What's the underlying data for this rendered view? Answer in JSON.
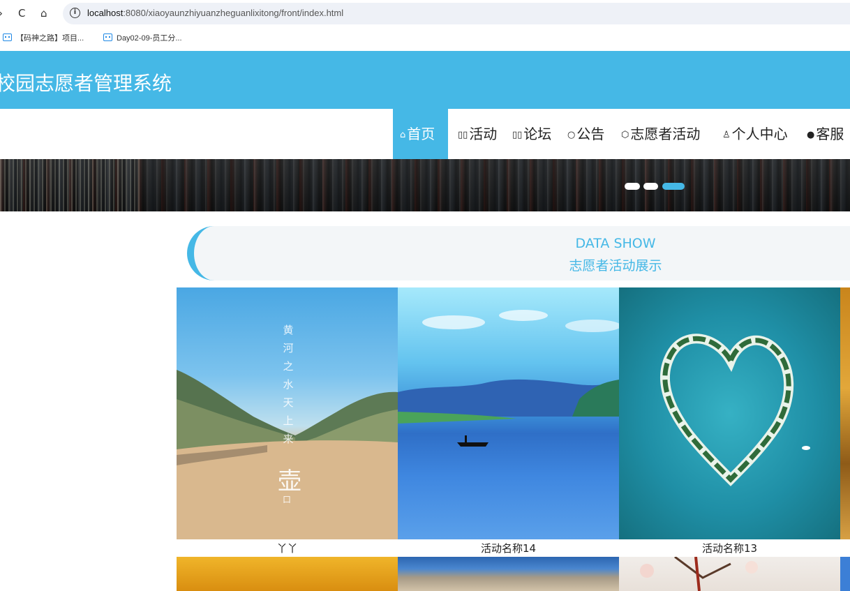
{
  "browser": {
    "back": "›",
    "reload": "C",
    "home": "⌂",
    "url_host": "localhost",
    "url_path": ":8080/xiaoyaunzhiyuanzheguanlixitong/front/index.html"
  },
  "bookmarks": [
    {
      "label": "【码神之路】项目..."
    },
    {
      "label": "Day02-09-员工分..."
    }
  ],
  "site": {
    "title": "校园志愿者管理系统"
  },
  "menu": [
    {
      "icon": "⌂",
      "label": "首页",
      "active": true
    },
    {
      "icon": "▯▯",
      "label": "活动",
      "active": false
    },
    {
      "icon": "▯▯",
      "label": "论坛",
      "active": false
    },
    {
      "icon": "○",
      "label": "公告",
      "active": false
    },
    {
      "icon": "⬡",
      "label": "志愿者活动",
      "active": false
    },
    {
      "icon": "♙",
      "label": "个人中心",
      "active": false
    },
    {
      "icon": "●",
      "label": "客服",
      "active": false
    }
  ],
  "carousel": {
    "slide_count": 3,
    "active_index": 2
  },
  "section": {
    "title_en": "DATA SHOW",
    "title_cn": "志愿者活动展示"
  },
  "activities": [
    {
      "name": "丫丫",
      "image_text": "黄河之水天上来",
      "image_seal": "壶",
      "image_seal_small": "口"
    },
    {
      "name": "活动名称14"
    },
    {
      "name": "活动名称13"
    }
  ],
  "colors": {
    "accent": "#45b8e6",
    "section_bg": "#f3f6f8"
  }
}
